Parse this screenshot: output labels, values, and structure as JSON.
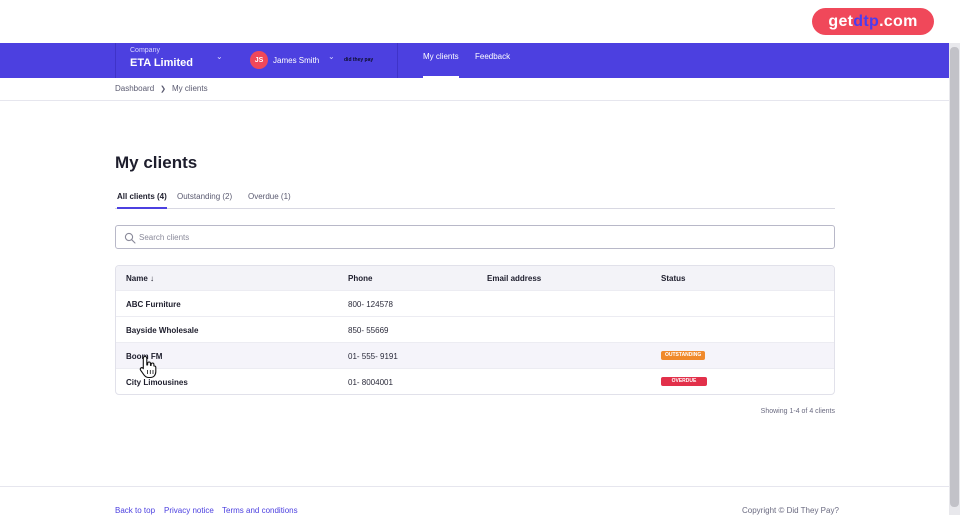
{
  "promo": {
    "prefix": "get",
    "brand": "dtp",
    "suffix": ".com"
  },
  "topbar": {
    "company_label": "Company",
    "company_name": "ETA Limited",
    "user_initials": "JS",
    "user_name": "James Smith",
    "logo_text": "did they pay",
    "nav": [
      {
        "label": "My clients",
        "active": true
      },
      {
        "label": "Feedback",
        "active": false
      }
    ]
  },
  "breadcrumb": {
    "items": [
      "Dashboard",
      "My clients"
    ]
  },
  "page_title": "My clients",
  "tabs": [
    {
      "label": "All clients (4)",
      "active": true
    },
    {
      "label": "Outstanding (2)",
      "active": false
    },
    {
      "label": "Overdue (1)",
      "active": false
    }
  ],
  "search": {
    "placeholder": "Search clients",
    "value": ""
  },
  "table": {
    "headers": {
      "name": "Name",
      "sort_icon": "arrow-down-icon",
      "phone": "Phone",
      "email": "Email address",
      "status": "Status"
    },
    "rows": [
      {
        "name": "ABC Furniture",
        "phone": "800- 124578",
        "email": "",
        "status": ""
      },
      {
        "name": "Bayside Wholesale",
        "phone": "850- 55669",
        "email": "",
        "status": ""
      },
      {
        "name": "Boom FM",
        "phone": "01- 555- 9191",
        "email": "",
        "status": "OUTSTANDING"
      },
      {
        "name": "City Limousines",
        "phone": "01- 8004001",
        "email": "",
        "status": "OVERDUE"
      }
    ]
  },
  "showing": "Showing 1-4 of 4 clients",
  "footer": {
    "links": [
      "Back to top",
      "Privacy notice",
      "Terms and conditions"
    ],
    "copyright": "Copyright © Did They Pay?"
  },
  "colors": {
    "brand": "#4c40e0",
    "accent": "#f0485a",
    "outstanding": "#f08a2c",
    "overdue": "#e2304a"
  }
}
